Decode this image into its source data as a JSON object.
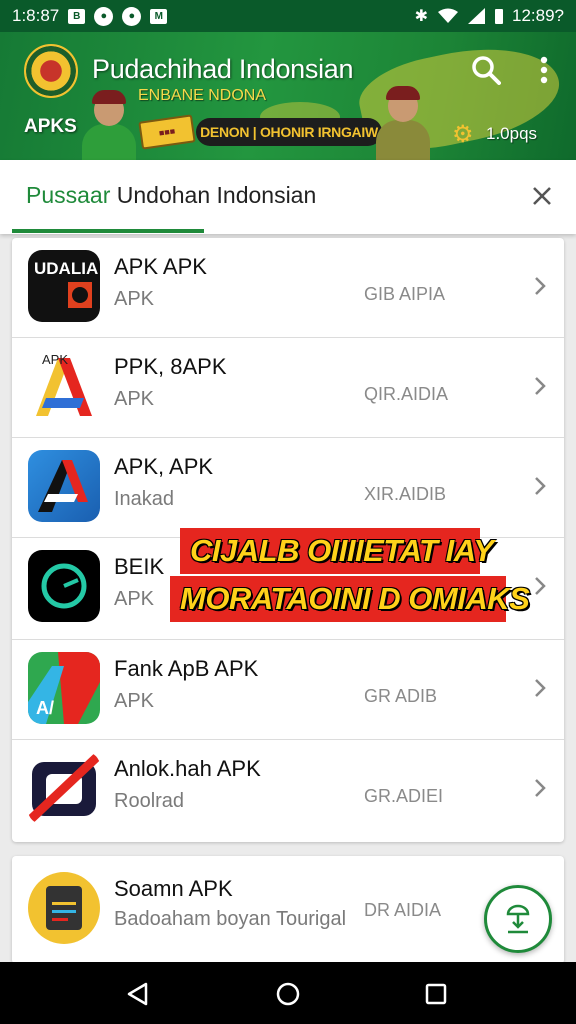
{
  "status_bar": {
    "time": "1:8:87",
    "clock": "12:89?"
  },
  "header": {
    "title": "Pudachihad Indonsian",
    "subtitle": "ENBANE NDONA",
    "badge": "APKS",
    "promo_text": "DENON | OHONIR IRNGAIW",
    "promo_count": "1.0pqs",
    "colors": {
      "header_green": "#1c8436",
      "accent_yellow": "#f2c230"
    }
  },
  "tab": {
    "label_accent": "Pussaar",
    "label_rest": "Undohan Indonsian",
    "accent_color": "#1f8a3a"
  },
  "apps": [
    {
      "name": "APK APK",
      "subtitle": "APK",
      "meta": "GIB AIPIA",
      "icon": "dark-square-app-icon"
    },
    {
      "name": "PPK, 8APK",
      "subtitle": "APK",
      "meta": "QIR.AIDIA",
      "icon": "colorful-a-app-icon"
    },
    {
      "name": "APK, APK",
      "subtitle": "Inakad",
      "meta": "XIR.AIDIB",
      "icon": "blue-a-app-icon"
    },
    {
      "name": "BEIK",
      "subtitle": "APK",
      "meta": "",
      "icon": "black-circle-app-icon"
    },
    {
      "name": "Fank ApB APK",
      "subtitle": "APK",
      "meta": "GR ADIB",
      "icon": "green-red-app-icon"
    },
    {
      "name": "Anlok.hah APK",
      "subtitle": "Roolrad",
      "meta": "GR.ADIEI",
      "icon": "blocked-app-icon"
    }
  ],
  "overlay": {
    "line1": "CIJALB OIIIIETAT IAY",
    "line2": "MORATAOINI D OMIAKS"
  },
  "featured_app": {
    "name": "Soamn APK",
    "subtitle": "Badoaham boyan Tourigal",
    "meta": "DR AIDIA",
    "icon": "yellow-circle-app-icon"
  }
}
